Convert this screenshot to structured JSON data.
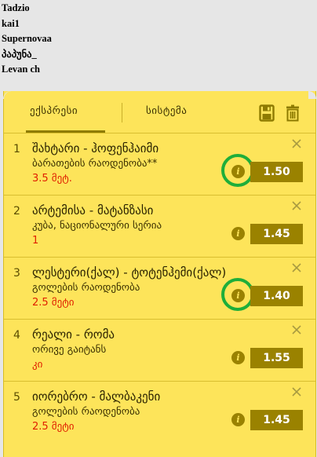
{
  "users": [
    "Tadzio",
    "kai1",
    "Supernovaa",
    "პაპუნა_",
    "Levan ch"
  ],
  "betslip": {
    "tab_express": "ექსპრესი",
    "tab_system": "სისტემა",
    "bets": [
      {
        "num": "1",
        "teams": "შახტარი - ჰოფენჰაიმი",
        "market": "ბარათების რაოდენობა**",
        "pick": "3.5 მეტ.",
        "odds": "1.50",
        "highlighted": true
      },
      {
        "num": "2",
        "teams": "არტემისა - მატანზასი",
        "market": "კუბა, ნაციონალური სერია",
        "pick": "1",
        "odds": "1.45",
        "highlighted": false
      },
      {
        "num": "3",
        "teams": "ლესტერი(ქალ) - ტოტენჰემი(ქალ)",
        "market": "გოლების რაოდენობა",
        "pick": "2.5 მეტი",
        "odds": "1.40",
        "highlighted": true
      },
      {
        "num": "4",
        "teams": "რეალი - რომა",
        "market": "ორივე გაიტანს",
        "pick": "კი",
        "odds": "1.55",
        "highlighted": false
      },
      {
        "num": "5",
        "teams": "იორებრო - მალბაკენი",
        "market": "გოლების რაოდენობა",
        "pick": "2.5 მეტი",
        "odds": "1.45",
        "highlighted": false
      }
    ]
  }
}
